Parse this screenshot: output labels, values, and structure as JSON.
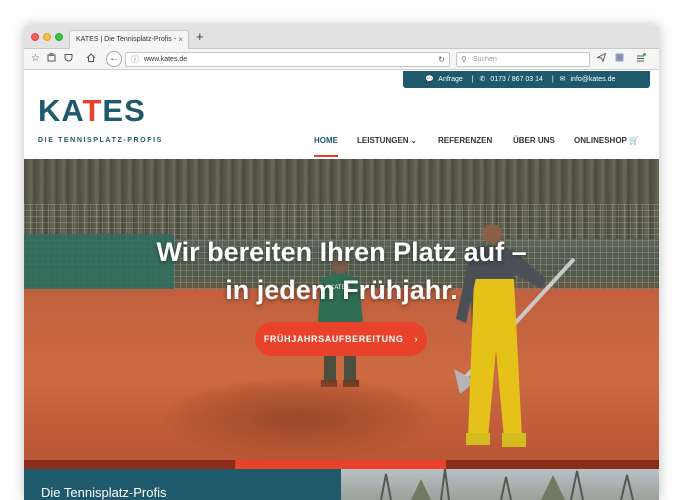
{
  "browser": {
    "tab_title": "KATES | Die Tennisplatz-Profis -",
    "tab_close": "×",
    "new_tab": "+",
    "url": "www.kates.de",
    "search_placeholder": "Suchen"
  },
  "topbar": {
    "anfrage": "Anfrage",
    "separator": "|",
    "phone": "0173 / 867 03 14",
    "email": "info@kates.de"
  },
  "logo": {
    "ka": "KA",
    "t": "T",
    "es": "ES",
    "tagline": "DIE TENNISPLATZ-PROFIS"
  },
  "nav": {
    "home": "HOME",
    "leistungen": "LEISTUNGEN",
    "referenzen": "REFERENZEN",
    "ueber_uns": "ÜBER UNS",
    "onlineshop": "ONLINESHOP"
  },
  "hero": {
    "line1": "Wir bereiten Ihren Platz auf –",
    "line2": "in jedem Frühjahr.",
    "button": "FRÜHJAHRSAUFBEREITUNG"
  },
  "bottom": {
    "title": "Die Tennisplatz-Profis"
  },
  "colors": {
    "brand_teal": "#1e5a6b",
    "brand_red": "#e8422b"
  }
}
